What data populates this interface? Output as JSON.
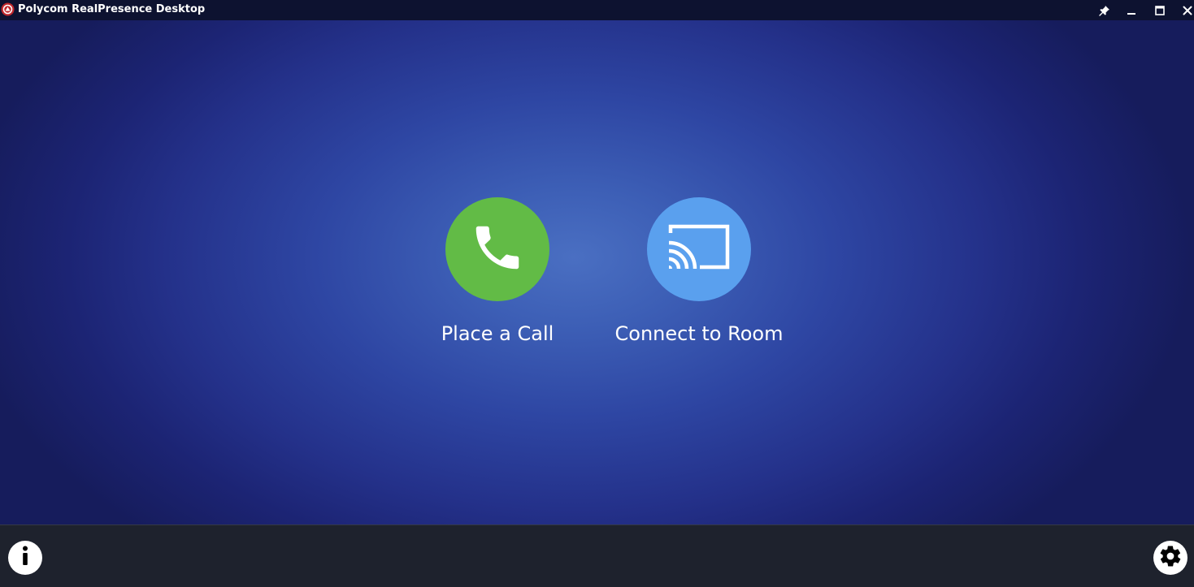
{
  "window": {
    "title": "Polycom RealPresence Desktop",
    "logo_icon": "polycom-logo-icon",
    "controls": {
      "pin_icon": "pin-icon",
      "minimize_icon": "minimize-icon",
      "maximize_icon": "maximize-icon",
      "close_icon": "close-icon"
    }
  },
  "main": {
    "actions": [
      {
        "label": "Place a Call",
        "icon": "phone-icon",
        "color": "#62bb46"
      },
      {
        "label": "Connect to Room",
        "icon": "cast-icon",
        "color": "#5aa0ee"
      }
    ]
  },
  "bottom_bar": {
    "info_icon": "info-icon",
    "settings_icon": "gear-icon"
  },
  "colors": {
    "titlebar": "#0d1230",
    "background_center": "#4a6fc2",
    "background_edge": "#161c5c",
    "bottom_bar": "#1e222d"
  }
}
